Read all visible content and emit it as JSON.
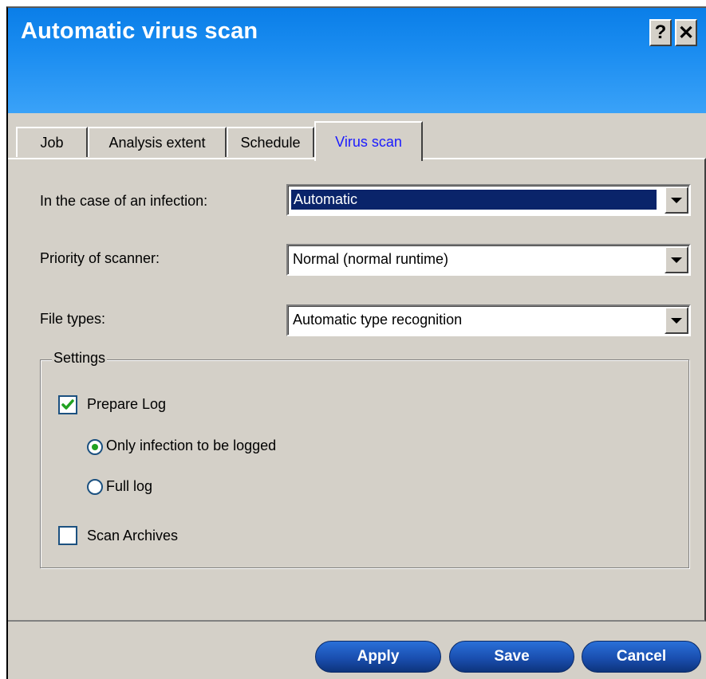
{
  "window": {
    "title": "Automatic virus scan",
    "help_label": "?",
    "close_label": "✕"
  },
  "tabs": [
    {
      "label": "Job"
    },
    {
      "label": "Analysis extent"
    },
    {
      "label": "Schedule"
    },
    {
      "label": "Virus scan",
      "active": true
    }
  ],
  "form": {
    "infection": {
      "label": "In the case of an infection:",
      "value": "Automatic"
    },
    "priority": {
      "label": "Priority of scanner:",
      "value": "Normal (normal runtime)"
    },
    "file_types": {
      "label": "File types:",
      "value": "Automatic type recognition"
    }
  },
  "settings": {
    "title": "Settings",
    "prepare_log": {
      "label": "Prepare Log",
      "checked": true
    },
    "only_infection": {
      "label": "Only infection to be logged",
      "selected": true
    },
    "full_log": {
      "label": "Full log",
      "selected": false
    },
    "scan_archives": {
      "label": "Scan Archives",
      "checked": false
    }
  },
  "buttons": {
    "apply": "Apply",
    "save": "Save",
    "cancel": "Cancel"
  },
  "colors": {
    "header_blue": "#1a8cf0",
    "active_tab_text": "#1a1aff",
    "button_blue": "#1a4fb0",
    "check_green": "#21a121"
  }
}
